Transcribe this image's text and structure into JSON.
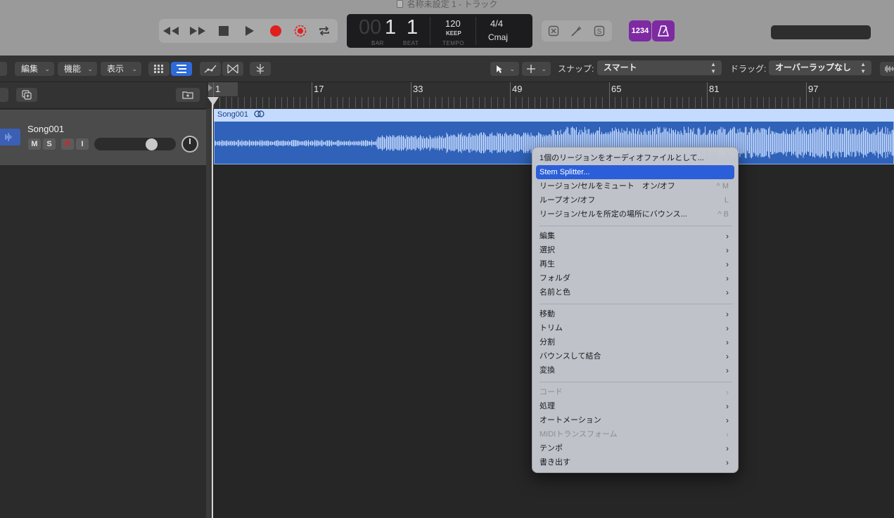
{
  "window": {
    "title": "名称未設定 1 - トラック"
  },
  "lcd": {
    "bar_dim": "00",
    "bar": "1",
    "beat": "1",
    "bar_caption": "BAR",
    "beat_caption": "BEAT",
    "tempo": "120",
    "tempo_mode": "KEEP",
    "tempo_caption": "TEMPO",
    "time_signature": "4/4",
    "key": "Cmaj"
  },
  "count_in_label": "1234",
  "toolbar": {
    "edit_label": "編集",
    "function_label": "機能",
    "view_label": "表示",
    "snap_label": "スナップ:",
    "snap_value": "スマート",
    "drag_label": "ドラッグ:",
    "drag_value": "オーバーラップなし"
  },
  "ruler": {
    "bars": [
      "1",
      "17",
      "33",
      "49",
      "65",
      "81",
      "97"
    ]
  },
  "track": {
    "name": "Song001",
    "mute": "M",
    "solo": "S",
    "record": "R",
    "input": "I",
    "volume": 0.8
  },
  "region": {
    "name": "Song001"
  },
  "context_menu": {
    "items": [
      {
        "label": "1個のリージョンをオーディオファイルとして...",
        "shortcut": ""
      },
      {
        "label": "Stem Splitter...",
        "shortcut": ""
      },
      {
        "label": "リージョン/セルをミュート　オン/オフ",
        "shortcut": "^ M"
      },
      {
        "label": "ループオン/オフ",
        "shortcut": "L"
      },
      {
        "label": "リージョン/セルを所定の場所にバウンス...",
        "shortcut": "^ B"
      },
      {
        "label": "編集",
        "submenu": true
      },
      {
        "label": "選択",
        "submenu": true
      },
      {
        "label": "再生",
        "submenu": true
      },
      {
        "label": "フォルダ",
        "submenu": true
      },
      {
        "label": "名前と色",
        "submenu": true
      },
      {
        "label": "移動",
        "submenu": true
      },
      {
        "label": "トリム",
        "submenu": true
      },
      {
        "label": "分割",
        "submenu": true
      },
      {
        "label": "バウンスして結合",
        "submenu": true
      },
      {
        "label": "変換",
        "submenu": true
      },
      {
        "label": "コード",
        "submenu": true
      },
      {
        "label": "処理",
        "submenu": true
      },
      {
        "label": "オートメーション",
        "submenu": true
      },
      {
        "label": "MIDIトランスフォーム",
        "submenu": true
      },
      {
        "label": "テンポ",
        "submenu": true
      },
      {
        "label": "書き出す",
        "submenu": true
      }
    ],
    "highlighted": "Stem Splitter...",
    "disabled": [
      "コード",
      "MIDIトランスフォーム"
    ],
    "highlight_color": "#2b5fd9"
  },
  "colors": {
    "record": "#e0201e",
    "region": "#2f62b8",
    "region_header": "#c4dbff",
    "track_icon": "#3a5fb5",
    "purple_button": "#7e2aa3"
  },
  "icons": {
    "transport": [
      "rewind-icon",
      "fast-forward-icon",
      "stop-icon",
      "play-icon",
      "record-icon",
      "capture-record-icon",
      "cycle-icon"
    ],
    "lcd_menu": "chevron-down-icon",
    "tools": [
      "close-box-icon",
      "tuning-fork-icon",
      "s-box-icon"
    ],
    "metronome": "metronome-icon",
    "tracklist": [
      "duplicate-icon",
      "new-folder-icon"
    ],
    "toolbar": [
      "grid-view-icon",
      "list-view-icon",
      "automation-curve-icon",
      "flex-icon",
      "catch-icon",
      "pointer-tool-icon",
      "marquee-tool-icon",
      "waveform-zoom-icon"
    ]
  }
}
